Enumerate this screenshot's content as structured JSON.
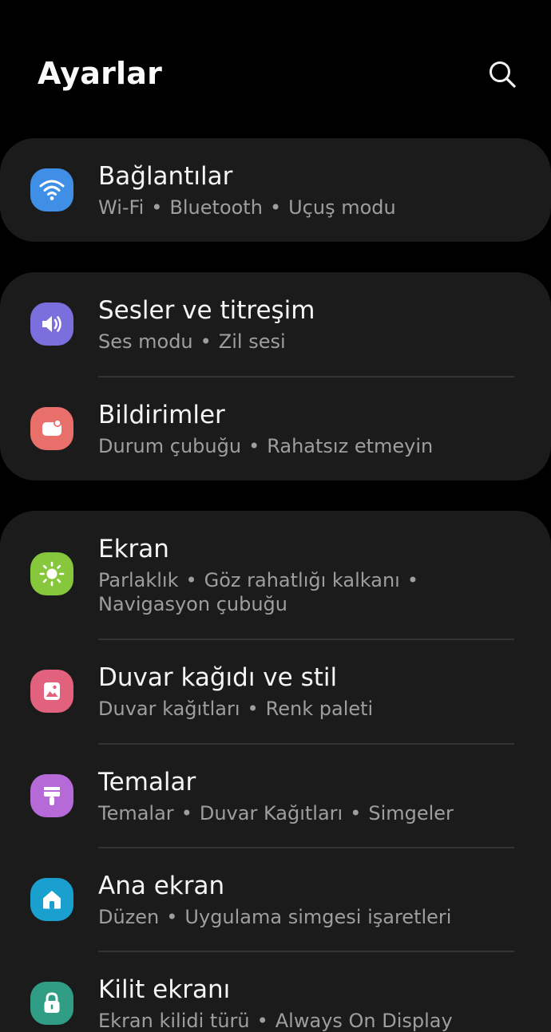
{
  "header": {
    "title": "Ayarlar",
    "search_icon": "search-icon"
  },
  "colors": {
    "background": "#000000",
    "card": "#1b1b1b",
    "connections": "#3f8fe6",
    "sounds": "#7b6fde",
    "notifications": "#e9706a",
    "display": "#86c73c",
    "wallpaper": "#e2627e",
    "themes": "#b56ad8",
    "home": "#1aa0cf",
    "lock": "#2f9e84"
  },
  "items": [
    {
      "title": "Bağlantılar",
      "subs": [
        "Wi-Fi",
        "Bluetooth",
        "Uçuş modu"
      ],
      "icon": "wifi-icon"
    },
    {
      "title": "Sesler ve titreşim",
      "subs": [
        "Ses modu",
        "Zil sesi"
      ],
      "icon": "speaker-icon"
    },
    {
      "title": "Bildirimler",
      "subs": [
        "Durum çubuğu",
        "Rahatsız etmeyin"
      ],
      "icon": "notification-icon"
    },
    {
      "title": "Ekran",
      "subs": [
        "Parlaklık",
        "Göz rahatlığı kalkanı",
        "Navigasyon çubuğu"
      ],
      "icon": "brightness-icon"
    },
    {
      "title": "Duvar kağıdı ve stil",
      "subs": [
        "Duvar kağıtları",
        "Renk paleti"
      ],
      "icon": "wallpaper-icon"
    },
    {
      "title": "Temalar",
      "subs": [
        "Temalar",
        "Duvar Kağıtları",
        "Simgeler"
      ],
      "icon": "paint-brush-icon"
    },
    {
      "title": "Ana ekran",
      "subs": [
        "Düzen",
        "Uygulama simgesi işaretleri"
      ],
      "icon": "home-icon"
    },
    {
      "title": "Kilit ekranı",
      "subs": [
        "Ekran kilidi türü",
        "Always On Display"
      ],
      "icon": "lock-icon"
    }
  ]
}
